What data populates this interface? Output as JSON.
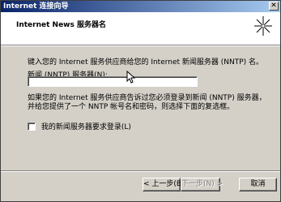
{
  "window": {
    "title": "Internet 连接向导",
    "close_glyph": "✕"
  },
  "header": {
    "title": "Internet News 服务器名"
  },
  "body": {
    "prompt": "键入您的 Internet 服务供应商给您的 Internet 新闻服务器 (NNTP) 名。",
    "field_label": "新闻 (NNTP) 服务器(N):",
    "field_value": "",
    "info": "如果您的 Internet 服务供应商告诉过您必须登录到新闻 (NNTP) 服务器，并给您提供了一个 NNTP 帐号名和密码，则选择下面的复选框。",
    "checkbox_label": "我的新闻服务器要求登录(L)",
    "checkbox_checked": false
  },
  "buttons": {
    "back": "< 上一步(B)",
    "next": "下一步(N) >",
    "cancel": "取消"
  },
  "colors": {
    "titlebar_start": "#0a246a",
    "titlebar_end": "#a6caf0",
    "face": "#d4d0c8"
  },
  "icons": [
    "close-icon",
    "wizard-sparkle-icon",
    "mouse-cursor-icon"
  ]
}
